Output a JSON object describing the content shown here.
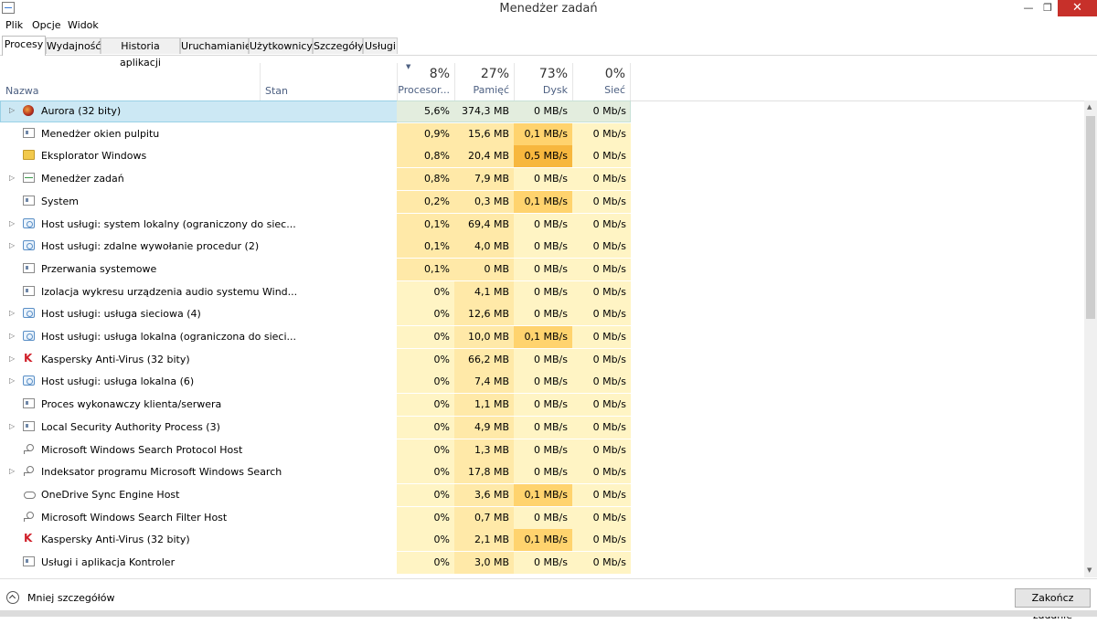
{
  "window": {
    "title": "Menedżer zadań",
    "controls": {
      "minimize": "—",
      "maximize": "❐",
      "close": "✕"
    }
  },
  "menu": [
    "Plik",
    "Opcje",
    "Widok"
  ],
  "tabs": [
    "Procesy",
    "Wydajność",
    "Historia aplikacji",
    "Uruchamianie",
    "Użytkownicy",
    "Szczegóły",
    "Usługi"
  ],
  "active_tab": "Procesy",
  "header": {
    "name": "Nazwa",
    "status": "Stan",
    "cpu": {
      "pct": "8%",
      "label": "Procesor..."
    },
    "memory": {
      "pct": "27%",
      "label": "Pamięć"
    },
    "disk": {
      "pct": "73%",
      "label": "Dysk"
    },
    "network": {
      "pct": "0%",
      "label": "Sieć"
    }
  },
  "heat_colors": {
    "light": "#fff4c4",
    "medium": "#ffe9a8",
    "strong": "#ffd36e",
    "hot": "#f7b73e",
    "selected": "#cce8f4"
  },
  "processes": [
    {
      "name": "Aurora (32 bity)",
      "icon": "aurora-icon",
      "expandable": true,
      "cpu": "5,6%",
      "mem": "374,3 MB",
      "disk": "0 MB/s",
      "net": "0 Mb/s"
    },
    {
      "name": "Menedżer okien pulpitu",
      "icon": "window-icon",
      "expandable": false,
      "cpu": "0,9%",
      "mem": "15,6 MB",
      "disk": "0,1 MB/s",
      "net": "0 Mb/s"
    },
    {
      "name": "Eksplorator Windows",
      "icon": "folder-icon",
      "expandable": false,
      "cpu": "0,8%",
      "mem": "20,4 MB",
      "disk": "0,5 MB/s",
      "net": "0 Mb/s"
    },
    {
      "name": "Menedżer zadań",
      "icon": "taskmgr-icon",
      "expandable": true,
      "cpu": "0,8%",
      "mem": "7,9 MB",
      "disk": "0 MB/s",
      "net": "0 Mb/s"
    },
    {
      "name": "System",
      "icon": "window-icon",
      "expandable": false,
      "cpu": "0,2%",
      "mem": "0,3 MB",
      "disk": "0,1 MB/s",
      "net": "0 Mb/s"
    },
    {
      "name": "Host usługi: system lokalny (ograniczony do siec...",
      "icon": "gear-icon",
      "expandable": true,
      "cpu": "0,1%",
      "mem": "69,4 MB",
      "disk": "0 MB/s",
      "net": "0 Mb/s"
    },
    {
      "name": "Host usługi: zdalne wywołanie procedur (2)",
      "icon": "gear-icon",
      "expandable": true,
      "cpu": "0,1%",
      "mem": "4,0 MB",
      "disk": "0 MB/s",
      "net": "0 Mb/s"
    },
    {
      "name": "Przerwania systemowe",
      "icon": "window-icon",
      "expandable": false,
      "cpu": "0,1%",
      "mem": "0 MB",
      "disk": "0 MB/s",
      "net": "0 Mb/s"
    },
    {
      "name": "Izolacja wykresu urządzenia audio systemu Wind...",
      "icon": "window-icon",
      "expandable": false,
      "cpu": "0%",
      "mem": "4,1 MB",
      "disk": "0 MB/s",
      "net": "0 Mb/s"
    },
    {
      "name": "Host usługi: usługa sieciowa (4)",
      "icon": "gear-icon",
      "expandable": true,
      "cpu": "0%",
      "mem": "12,6 MB",
      "disk": "0 MB/s",
      "net": "0 Mb/s"
    },
    {
      "name": "Host usługi: usługa lokalna (ograniczona do sieci...",
      "icon": "gear-icon",
      "expandable": true,
      "cpu": "0%",
      "mem": "10,0 MB",
      "disk": "0,1 MB/s",
      "net": "0 Mb/s"
    },
    {
      "name": "Kaspersky Anti-Virus (32 bity)",
      "icon": "kaspersky-icon",
      "expandable": true,
      "cpu": "0%",
      "mem": "66,2 MB",
      "disk": "0 MB/s",
      "net": "0 Mb/s"
    },
    {
      "name": "Host usługi: usługa lokalna (6)",
      "icon": "gear-icon",
      "expandable": true,
      "cpu": "0%",
      "mem": "7,4 MB",
      "disk": "0 MB/s",
      "net": "0 Mb/s"
    },
    {
      "name": "Proces wykonawczy klienta/serwera",
      "icon": "window-icon",
      "expandable": false,
      "cpu": "0%",
      "mem": "1,1 MB",
      "disk": "0 MB/s",
      "net": "0 Mb/s"
    },
    {
      "name": "Local Security Authority Process (3)",
      "icon": "window-icon",
      "expandable": true,
      "cpu": "0%",
      "mem": "4,9 MB",
      "disk": "0 MB/s",
      "net": "0 Mb/s"
    },
    {
      "name": "Microsoft Windows Search Protocol Host",
      "icon": "search-icon",
      "expandable": false,
      "cpu": "0%",
      "mem": "1,3 MB",
      "disk": "0 MB/s",
      "net": "0 Mb/s"
    },
    {
      "name": "Indeksator programu Microsoft Windows Search",
      "icon": "search-icon",
      "expandable": true,
      "cpu": "0%",
      "mem": "17,8 MB",
      "disk": "0 MB/s",
      "net": "0 Mb/s"
    },
    {
      "name": "OneDrive Sync Engine Host",
      "icon": "cloud-icon",
      "expandable": false,
      "cpu": "0%",
      "mem": "3,6 MB",
      "disk": "0,1 MB/s",
      "net": "0 Mb/s"
    },
    {
      "name": "Microsoft Windows Search Filter Host",
      "icon": "search-icon",
      "expandable": false,
      "cpu": "0%",
      "mem": "0,7 MB",
      "disk": "0 MB/s",
      "net": "0 Mb/s"
    },
    {
      "name": "Kaspersky Anti-Virus (32 bity)",
      "icon": "kaspersky-icon",
      "expandable": false,
      "cpu": "0%",
      "mem": "2,1 MB",
      "disk": "0,1 MB/s",
      "net": "0 Mb/s"
    },
    {
      "name": "Usługi i aplikacja Kontroler",
      "icon": "window-icon",
      "expandable": false,
      "cpu": "0%",
      "mem": "3,0 MB",
      "disk": "0 MB/s",
      "net": "0 Mb/s"
    }
  ],
  "footer": {
    "fewer_details": "Mniej szczegółów",
    "end_task": "Zakończ zadanie"
  }
}
